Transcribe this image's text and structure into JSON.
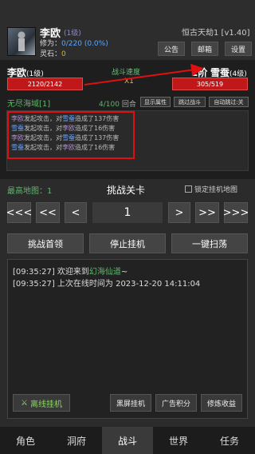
{
  "header": {
    "player_name": "李欧",
    "player_level": "(1级)",
    "cultivation_label": "修为：",
    "cultivation_value": "0/220 (0.0%)",
    "spirit_label": "灵石：",
    "spirit_value": "0",
    "server_name": "恒古天劫1 [v1.40]",
    "buttons": {
      "notice": "公告",
      "mail": "邮箱",
      "settings": "设置"
    }
  },
  "battle": {
    "left": {
      "name": "李欧",
      "level": "(1级)",
      "hp": "2120/2142"
    },
    "right": {
      "stage": "2阶",
      "name": "雪蚕",
      "level": "(4级)",
      "hp": "305/519"
    },
    "speed_label": "战斗速度",
    "speed_value": "X1",
    "map_name": "无尽海域[1]",
    "round_current": "4/100",
    "round_label": "回合",
    "buttons": {
      "attributes": "显示属性",
      "skip": "跳过战斗",
      "auto_skip": "自动跳过:关"
    },
    "log": [
      {
        "attacker": "李欧",
        "mid": "发起攻击，对",
        "target": "雪蚕",
        "result": "造成了137伤害",
        "attacker_color": "purple",
        "target_color": "blue"
      },
      {
        "attacker": "雪蚕",
        "mid": "发起攻击，对",
        "target": "李欧",
        "result": "造成了16伤害",
        "attacker_color": "blue",
        "target_color": "purple"
      },
      {
        "attacker": "李欧",
        "mid": "发起攻击，对",
        "target": "雪蚕",
        "result": "造成了137伤害",
        "attacker_color": "purple",
        "target_color": "blue"
      },
      {
        "attacker": "雪蚕",
        "mid": "发起攻击，对",
        "target": "李欧",
        "result": "造成了16伤害",
        "attacker_color": "blue",
        "target_color": "purple"
      }
    ]
  },
  "stage": {
    "highest_map": "最高地图：1",
    "title": "挑战关卡",
    "lock_label": "锁定挂机地图",
    "current": "1",
    "nav": {
      "first": "<<<",
      "prev10": "<<",
      "prev": "<",
      "next": ">",
      "next10": ">>",
      "last": ">>>"
    },
    "actions": {
      "boss": "挑战首领",
      "stop": "停止挂机",
      "sweep": "一键扫荡"
    }
  },
  "messages": {
    "lines": [
      {
        "time": "[09:35:27]",
        "text": "欢迎来到",
        "highlight": "幻海仙道",
        "suffix": "~"
      },
      {
        "time": "[09:35:27]",
        "text": "上次在线时间为  2023-12-20 14:11:04",
        "highlight": "",
        "suffix": ""
      }
    ],
    "buttons": {
      "offline": "离线挂机",
      "blackscreen": "黑屏挂机",
      "ad_points": "广告积分",
      "cultivate": "修炼收益"
    }
  },
  "nav": {
    "tabs": [
      {
        "label": "角色",
        "active": false
      },
      {
        "label": "洞府",
        "active": false
      },
      {
        "label": "战斗",
        "active": true
      },
      {
        "label": "世界",
        "active": false
      },
      {
        "label": "任务",
        "active": false
      }
    ]
  },
  "colors": {
    "hp_red": "#c01818",
    "accent_green": "#5bb86a",
    "highlight_red": "#e01010",
    "blue": "#6ea6ff",
    "purple": "#b78ae0"
  }
}
